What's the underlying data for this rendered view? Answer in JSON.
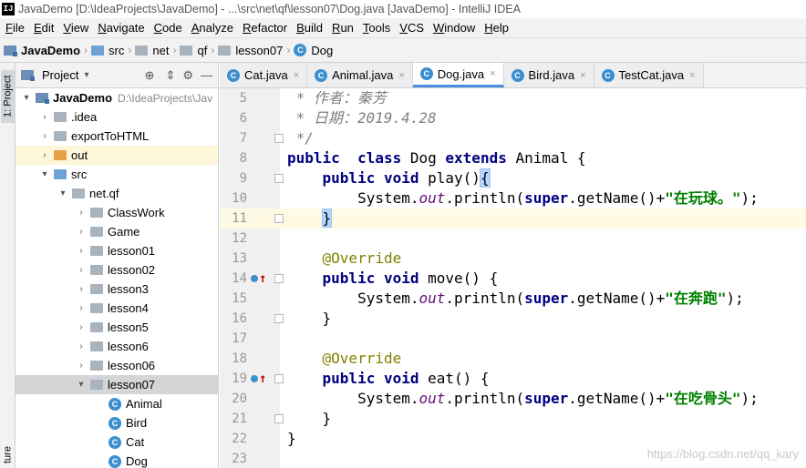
{
  "window": {
    "title": "JavaDemo [D:\\IdeaProjects\\JavaDemo] - ...\\src\\net\\qf\\lesson07\\Dog.java [JavaDemo] - IntelliJ IDEA",
    "logo": "IJ"
  },
  "menu": [
    "File",
    "Edit",
    "View",
    "Navigate",
    "Code",
    "Analyze",
    "Refactor",
    "Build",
    "Run",
    "Tools",
    "VCS",
    "Window",
    "Help"
  ],
  "breadcrumbs": [
    "JavaDemo",
    "src",
    "net",
    "qf",
    "lesson07",
    "Dog"
  ],
  "side_strip": {
    "project_tab": "1: Project",
    "structure_tab": "ture"
  },
  "project_panel": {
    "title": "Project"
  },
  "tree": [
    {
      "label": "JavaDemo",
      "path": "D:\\IdeaProjects\\Jav",
      "arrow": "▾",
      "indent": 0,
      "icon": "module-folder-icon",
      "bold": true
    },
    {
      "label": ".idea",
      "arrow": "›",
      "indent": 1,
      "icon": "folder-icon"
    },
    {
      "label": "exportToHTML",
      "arrow": "›",
      "indent": 1,
      "icon": "folder-icon"
    },
    {
      "label": "out",
      "arrow": "›",
      "indent": 1,
      "icon": "orange-folder-icon",
      "highlight": "yellow"
    },
    {
      "label": "src",
      "arrow": "▾",
      "indent": 1,
      "icon": "source-folder-icon"
    },
    {
      "label": "net.qf",
      "arrow": "▾",
      "indent": 2,
      "icon": "package-icon"
    },
    {
      "label": "ClassWork",
      "arrow": "›",
      "indent": 3,
      "icon": "package-icon"
    },
    {
      "label": "Game",
      "arrow": "›",
      "indent": 3,
      "icon": "package-icon"
    },
    {
      "label": "lesson01",
      "arrow": "›",
      "indent": 3,
      "icon": "package-icon"
    },
    {
      "label": "lesson02",
      "arrow": "›",
      "indent": 3,
      "icon": "package-icon"
    },
    {
      "label": "lesson3",
      "arrow": "›",
      "indent": 3,
      "icon": "package-icon"
    },
    {
      "label": "lesson4",
      "arrow": "›",
      "indent": 3,
      "icon": "package-icon"
    },
    {
      "label": "lesson5",
      "arrow": "›",
      "indent": 3,
      "icon": "package-icon"
    },
    {
      "label": "lesson6",
      "arrow": "›",
      "indent": 3,
      "icon": "package-icon"
    },
    {
      "label": "lesson06",
      "arrow": "›",
      "indent": 3,
      "icon": "package-icon"
    },
    {
      "label": "lesson07",
      "arrow": "▾",
      "indent": 3,
      "icon": "package-icon",
      "highlight": "selected"
    },
    {
      "label": "Animal",
      "arrow": "",
      "indent": 4,
      "icon": "class-icon"
    },
    {
      "label": "Bird",
      "arrow": "",
      "indent": 4,
      "icon": "class-icon"
    },
    {
      "label": "Cat",
      "arrow": "",
      "indent": 4,
      "icon": "class-icon"
    },
    {
      "label": "Dog",
      "arrow": "",
      "indent": 4,
      "icon": "class-icon"
    }
  ],
  "tabs": [
    {
      "label": "Cat.java",
      "active": false
    },
    {
      "label": "Animal.java",
      "active": false
    },
    {
      "label": "Dog.java",
      "active": true
    },
    {
      "label": "Bird.java",
      "active": false
    },
    {
      "label": "TestCat.java",
      "active": false
    }
  ],
  "tab_close_glyph": "×",
  "code_lines": [
    {
      "num": "5",
      "tokens": [
        [
          "cmt",
          " * 作者：秦芳"
        ]
      ]
    },
    {
      "num": "6",
      "tokens": [
        [
          "cmt",
          " * 日期：2019.4.28"
        ]
      ]
    },
    {
      "num": "7",
      "tokens": [
        [
          "cmt",
          " */"
        ]
      ],
      "fold": true
    },
    {
      "num": "8",
      "tokens": [
        [
          "kw",
          "public"
        ],
        [
          "",
          "  "
        ],
        [
          "kw",
          "class"
        ],
        [
          "",
          " Dog "
        ],
        [
          "kw",
          "extends"
        ],
        [
          "",
          " Animal {"
        ]
      ]
    },
    {
      "num": "9",
      "tokens": [
        [
          "",
          "    "
        ],
        [
          "kw",
          "public"
        ],
        [
          "",
          " "
        ],
        [
          "kw",
          "void"
        ],
        [
          "",
          " play()"
        ],
        [
          "br",
          "{"
        ]
      ],
      "fold": true
    },
    {
      "num": "10",
      "tokens": [
        [
          "",
          "        System."
        ],
        [
          "fld",
          "out"
        ],
        [
          "",
          ".println("
        ],
        [
          "kw",
          "super"
        ],
        [
          "",
          ".getName()+"
        ],
        [
          "str",
          "\"在玩球。\""
        ],
        [
          "",
          ");"
        ]
      ]
    },
    {
      "num": "11",
      "tokens": [
        [
          "",
          "    "
        ],
        [
          "br",
          "}"
        ]
      ],
      "fold": true,
      "current": true
    },
    {
      "num": "12",
      "tokens": []
    },
    {
      "num": "13",
      "tokens": [
        [
          "",
          "    "
        ],
        [
          "ann",
          "@Override"
        ]
      ]
    },
    {
      "num": "14",
      "tokens": [
        [
          "",
          "    "
        ],
        [
          "kw",
          "public"
        ],
        [
          "",
          " "
        ],
        [
          "kw",
          "void"
        ],
        [
          "",
          " move() {"
        ]
      ],
      "override": true,
      "fold": true
    },
    {
      "num": "15",
      "tokens": [
        [
          "",
          "        System."
        ],
        [
          "fld",
          "out"
        ],
        [
          "",
          ".println("
        ],
        [
          "kw",
          "super"
        ],
        [
          "",
          ".getName()+"
        ],
        [
          "str",
          "\"在奔跑\""
        ],
        [
          "",
          ");"
        ]
      ]
    },
    {
      "num": "16",
      "tokens": [
        [
          "",
          "    }"
        ]
      ],
      "fold": true
    },
    {
      "num": "17",
      "tokens": []
    },
    {
      "num": "18",
      "tokens": [
        [
          "",
          "    "
        ],
        [
          "ann",
          "@Override"
        ]
      ]
    },
    {
      "num": "19",
      "tokens": [
        [
          "",
          "    "
        ],
        [
          "kw",
          "public"
        ],
        [
          "",
          " "
        ],
        [
          "kw",
          "void"
        ],
        [
          "",
          " eat() {"
        ]
      ],
      "override": true,
      "fold": true
    },
    {
      "num": "20",
      "tokens": [
        [
          "",
          "        System."
        ],
        [
          "fld",
          "out"
        ],
        [
          "",
          ".println("
        ],
        [
          "kw",
          "super"
        ],
        [
          "",
          ".getName()+"
        ],
        [
          "str",
          "\"在吃骨头\""
        ],
        [
          "",
          ");"
        ]
      ]
    },
    {
      "num": "21",
      "tokens": [
        [
          "",
          "    }"
        ]
      ],
      "fold": true
    },
    {
      "num": "22",
      "tokens": [
        [
          "",
          "}"
        ]
      ]
    },
    {
      "num": "23",
      "tokens": []
    }
  ],
  "watermark": "https://blog.csdn.net/qq_kary"
}
